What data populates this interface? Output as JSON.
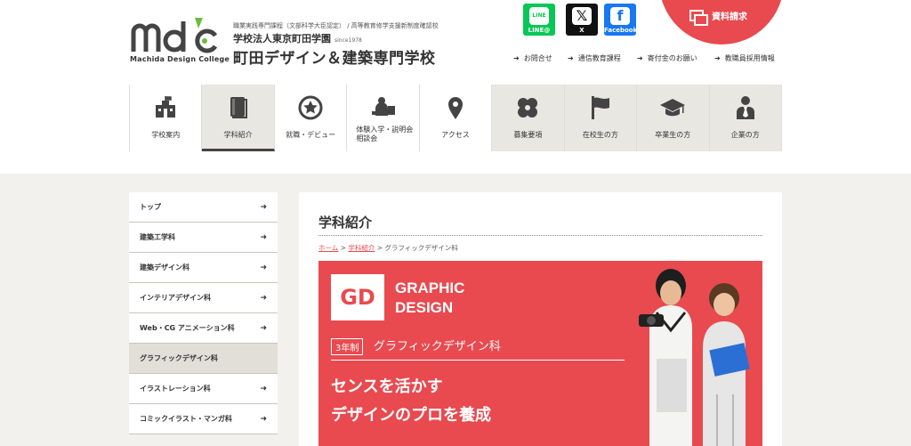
{
  "header": {
    "logo_sub": "Machida Design College",
    "tagline_1": "職業実践専門課程（文部科学大臣認定） / 高等教育修学支援新制度確認校",
    "corp": "学校法人東京町田学園",
    "since": "since1978",
    "school_name": "町田デザイン＆建築専門学校",
    "sns": [
      {
        "name": "LINE@",
        "color": "#06c755",
        "glyph": "LINE"
      },
      {
        "name": "X",
        "color": "#111111",
        "glyph": "𝕏"
      },
      {
        "name": "Facebook",
        "color": "#1877f2",
        "glyph": "f"
      }
    ],
    "request_label": "資料請求",
    "utility_links": [
      "お問合せ",
      "通信教育課程",
      "寄付金のお願い",
      "教職員採用情報"
    ]
  },
  "nav": [
    {
      "label": "学校案内",
      "icon": "school-icon"
    },
    {
      "label": "学科紹介",
      "icon": "book-icon"
    },
    {
      "label": "就職・デビュー",
      "icon": "star-badge-icon"
    },
    {
      "label": "体験入学・説明会\n相談会",
      "icon": "person-desk-icon"
    },
    {
      "label": "アクセス",
      "icon": "map-pin-icon"
    },
    {
      "label": "募集要項",
      "icon": "clover-icon"
    },
    {
      "label": "在校生の方",
      "icon": "flag-icon"
    },
    {
      "label": "卒業生の方",
      "icon": "grad-cap-icon"
    },
    {
      "label": "企業の方",
      "icon": "businessman-icon"
    }
  ],
  "sidebar": [
    {
      "label": "トップ"
    },
    {
      "label": "建築工学科"
    },
    {
      "label": "建築デザイン科"
    },
    {
      "label": "インテリアデザイン科"
    },
    {
      "label": "Web・CG アニメーション科"
    },
    {
      "label": "グラフィックデザイン科"
    },
    {
      "label": "イラストレーション科"
    },
    {
      "label": "コミックイラスト・マンガ科"
    }
  ],
  "content": {
    "title": "学科紹介",
    "breadcrumb": {
      "home": "ホーム",
      "sep": " > ",
      "parent": "学科紹介",
      "current": "グラフィックデザイン科"
    },
    "banner": {
      "badge": "GD",
      "title_line1": "GRAPHIC",
      "title_line2": "DESIGN",
      "years": "3年制",
      "dept": "グラフィックデザイン科",
      "catch_line1": "センスを活かす",
      "catch_line2": "デザインのプロを養成"
    }
  },
  "colors": {
    "accent": "#e84a4f",
    "nav_active_bg": "#e9e7e2",
    "page_bg": "#f3f1ed"
  }
}
